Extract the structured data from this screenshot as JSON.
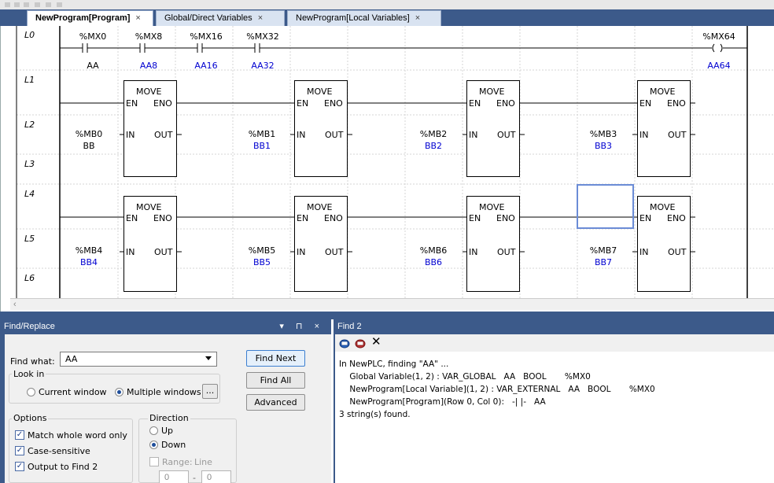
{
  "tabs": [
    {
      "label": "NewProgram[Program]",
      "active": true
    },
    {
      "label": "Global/Direct Variables",
      "active": false
    },
    {
      "label": "NewProgram[Local Variables]",
      "active": false
    }
  ],
  "tab_close_glyph": "×",
  "ladder": {
    "row_labels": [
      "L0",
      "L1",
      "L2",
      "L3",
      "L4",
      "L5",
      "L6"
    ],
    "contacts": [
      {
        "address": "%MX0",
        "name": "AA"
      },
      {
        "address": "%MX8",
        "name": "AA8"
      },
      {
        "address": "%MX16",
        "name": "AA16"
      },
      {
        "address": "%MX32",
        "name": "AA32"
      }
    ],
    "coil": {
      "address": "%MX64",
      "name": "AA64"
    },
    "function_block": {
      "title": "MOVE",
      "en": "EN",
      "eno": "ENO",
      "in": "IN",
      "out": "OUT"
    },
    "move_inputs": [
      {
        "address": "%MB0",
        "name": "BB"
      },
      {
        "address": "%MB1",
        "name": "BB1"
      },
      {
        "address": "%MB2",
        "name": "BB2"
      },
      {
        "address": "%MB3",
        "name": "BB3"
      },
      {
        "address": "%MB4",
        "name": "BB4"
      },
      {
        "address": "%MB5",
        "name": "BB5"
      },
      {
        "address": "%MB6",
        "name": "BB6"
      },
      {
        "address": "%MB7",
        "name": "BB7"
      }
    ]
  },
  "find_panel": {
    "title": "Find/Replace",
    "header_controls": "▾ ⊓ ×",
    "find_what_label": "Find what:",
    "find_what_value": "AA",
    "look_in_label": "Look in",
    "look_in_options": [
      "Current window",
      "Multiple windows"
    ],
    "look_in_selected": "Multiple windows",
    "browse_label": "...",
    "buttons": {
      "find_next": "Find Next",
      "find_all": "Find All",
      "advanced": "Advanced"
    },
    "options_label": "Options",
    "options": [
      {
        "label": "Match whole word only",
        "checked": true
      },
      {
        "label": "Case-sensitive",
        "checked": true
      },
      {
        "label": "Output to Find 2",
        "checked": true
      }
    ],
    "direction_label": "Direction",
    "direction_options": [
      "Up",
      "Down"
    ],
    "direction_selected": "Down",
    "range_label": "Range:",
    "range_unit": "Line",
    "range_from": "0",
    "range_sep": "-",
    "range_to": "0"
  },
  "find2_panel": {
    "title": "Find 2",
    "clear_glyph": "✕",
    "output_lines": [
      "In NewPLC, finding \"AA\" ...",
      "    Global Variable(1, 2) : VAR_GLOBAL   AA   BOOL       %MX0",
      "    NewProgram[Local Variable](1, 2) : VAR_EXTERNAL   AA   BOOL       %MX0",
      "    NewProgram[Program](Row 0, Col 0):   -| |-   AA",
      "3 string(s) found."
    ]
  },
  "colors": {
    "accent": "#3c5a8a",
    "symbol_blue": "#0000d0",
    "selection": "#6b8cd6"
  }
}
